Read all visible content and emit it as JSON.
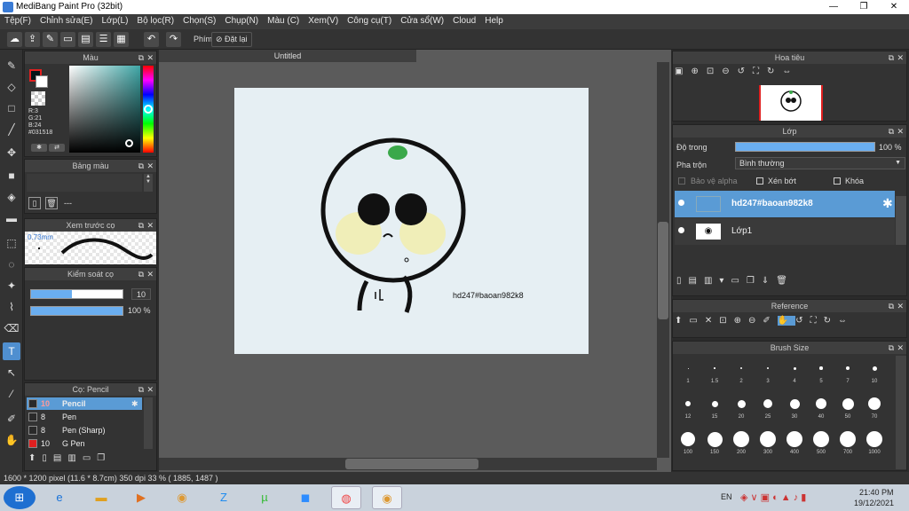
{
  "app": {
    "title": "MediBang Paint Pro (32bit)"
  },
  "window_buttons": [
    "—",
    "❐",
    "✕"
  ],
  "menu": [
    "Tệp(F)",
    "Chỉnh sửa(E)",
    "Lớp(L)",
    "Bộ lọc(R)",
    "Chọn(S)",
    "Chụp(N)",
    "Màu (C)",
    "Xem(V)",
    "Công cụ(T)",
    "Cửa sổ(W)",
    "Cloud",
    "Help"
  ],
  "toolbar": {
    "shortcut_label": "Phím",
    "reset_label": "Đặt lại"
  },
  "color_panel": {
    "title": "Màu",
    "r": "R:3",
    "g": "G:21",
    "b": "B:24",
    "hex": "#031518",
    "accent": "#031518"
  },
  "palette_panel": {
    "title": "Bảng màu",
    "value": "---"
  },
  "brush_preview": {
    "title": "Xem trước cọ",
    "size": "0.73mm"
  },
  "brush_control": {
    "title": "Kiểm soát cọ",
    "size_value": "10",
    "opacity_value": "100 %",
    "size_fill": 0.45,
    "opacity_fill": 1.0
  },
  "brush_list": {
    "title": "Cọ: Pencil",
    "items": [
      {
        "size": "10",
        "name": "Pencil",
        "color": "#2a2a2a",
        "selected": true
      },
      {
        "size": "8",
        "name": "Pen",
        "color": "#2a2a2a",
        "selected": false
      },
      {
        "size": "8",
        "name": "Pen (Sharp)",
        "color": "#2a2a2a",
        "selected": false
      },
      {
        "size": "10",
        "name": "G Pen",
        "color": "#e02020",
        "selected": false
      }
    ]
  },
  "document": {
    "tab": "Untitled",
    "watermark_text": "hd247#baoan982k8"
  },
  "navigator": {
    "title": "Hoa tiêu"
  },
  "layer_panel": {
    "title": "Lớp",
    "opacity_label": "Độ trong",
    "opacity_value": "100 %",
    "opacity_fill": 1.0,
    "blend_label": "Pha trộn",
    "blend_value": "Bình thường",
    "protect_alpha": "Bảo vệ alpha",
    "clipping": "Xén bớt",
    "lock": "Khóa",
    "layers": [
      {
        "name": "hd247#baoan982k8",
        "selected": true
      },
      {
        "name": "Lớp1",
        "selected": false
      }
    ]
  },
  "reference_panel": {
    "title": "Reference"
  },
  "brush_size_panel": {
    "title": "Brush Size",
    "sizes": [
      "1",
      "1.5",
      "2",
      "3",
      "4",
      "5",
      "7",
      "10",
      "12",
      "15",
      "20",
      "25",
      "30",
      "40",
      "50",
      "70",
      "100",
      "150",
      "200",
      "300",
      "400",
      "500",
      "700",
      "1000"
    ]
  },
  "status": {
    "text": "1600 * 1200 pixel   (11.6 * 8.7cm)   350 dpi   33 %   ( 1885, 1487 )"
  },
  "taskbar": {
    "language": "EN",
    "time": "21:40 PM",
    "date": "19/12/2021",
    "apps": [
      "start",
      "ie",
      "explorer",
      "media",
      "chrome",
      "zalo",
      "utorrent",
      "zoom",
      "medibang",
      "chrome2"
    ]
  }
}
